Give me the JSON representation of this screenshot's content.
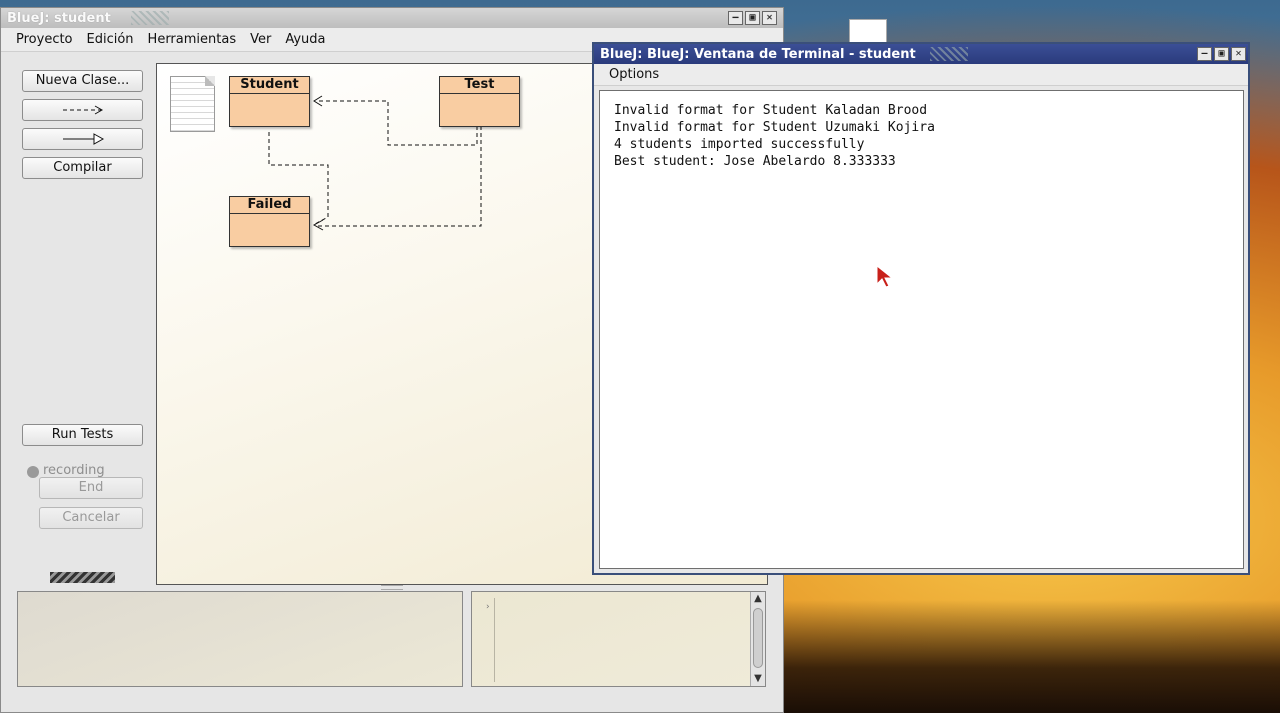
{
  "main_window": {
    "title": "BlueJ:  student",
    "menu": [
      "Proyecto",
      "Edición",
      "Herramientas",
      "Ver",
      "Ayuda"
    ],
    "buttons": {
      "new_class": "Nueva Clase...",
      "dependency_arrow": "--->",
      "inheritance_arrow": "—▷",
      "compile": "Compilar",
      "run_tests": "Run Tests",
      "recording": "recording",
      "end": "End",
      "cancel": "Cancelar"
    },
    "classes": [
      "Student",
      "Test",
      "Failed"
    ]
  },
  "terminal_window": {
    "title": "BlueJ: BlueJ:  Ventana de Terminal - student",
    "menu_options": "Options",
    "output": [
      "Invalid format for Student Kaladan Brood",
      "Invalid format for Student Uzumaki Kojira",
      "4 students imported successfully",
      "Best student: Jose Abelardo 8.333333"
    ]
  },
  "window_controls": {
    "minimize": "–",
    "maximize": "▣",
    "close": "✕"
  },
  "colors": {
    "class_fill": "#f9cda2",
    "terminal_title": "#2a3b7c"
  }
}
